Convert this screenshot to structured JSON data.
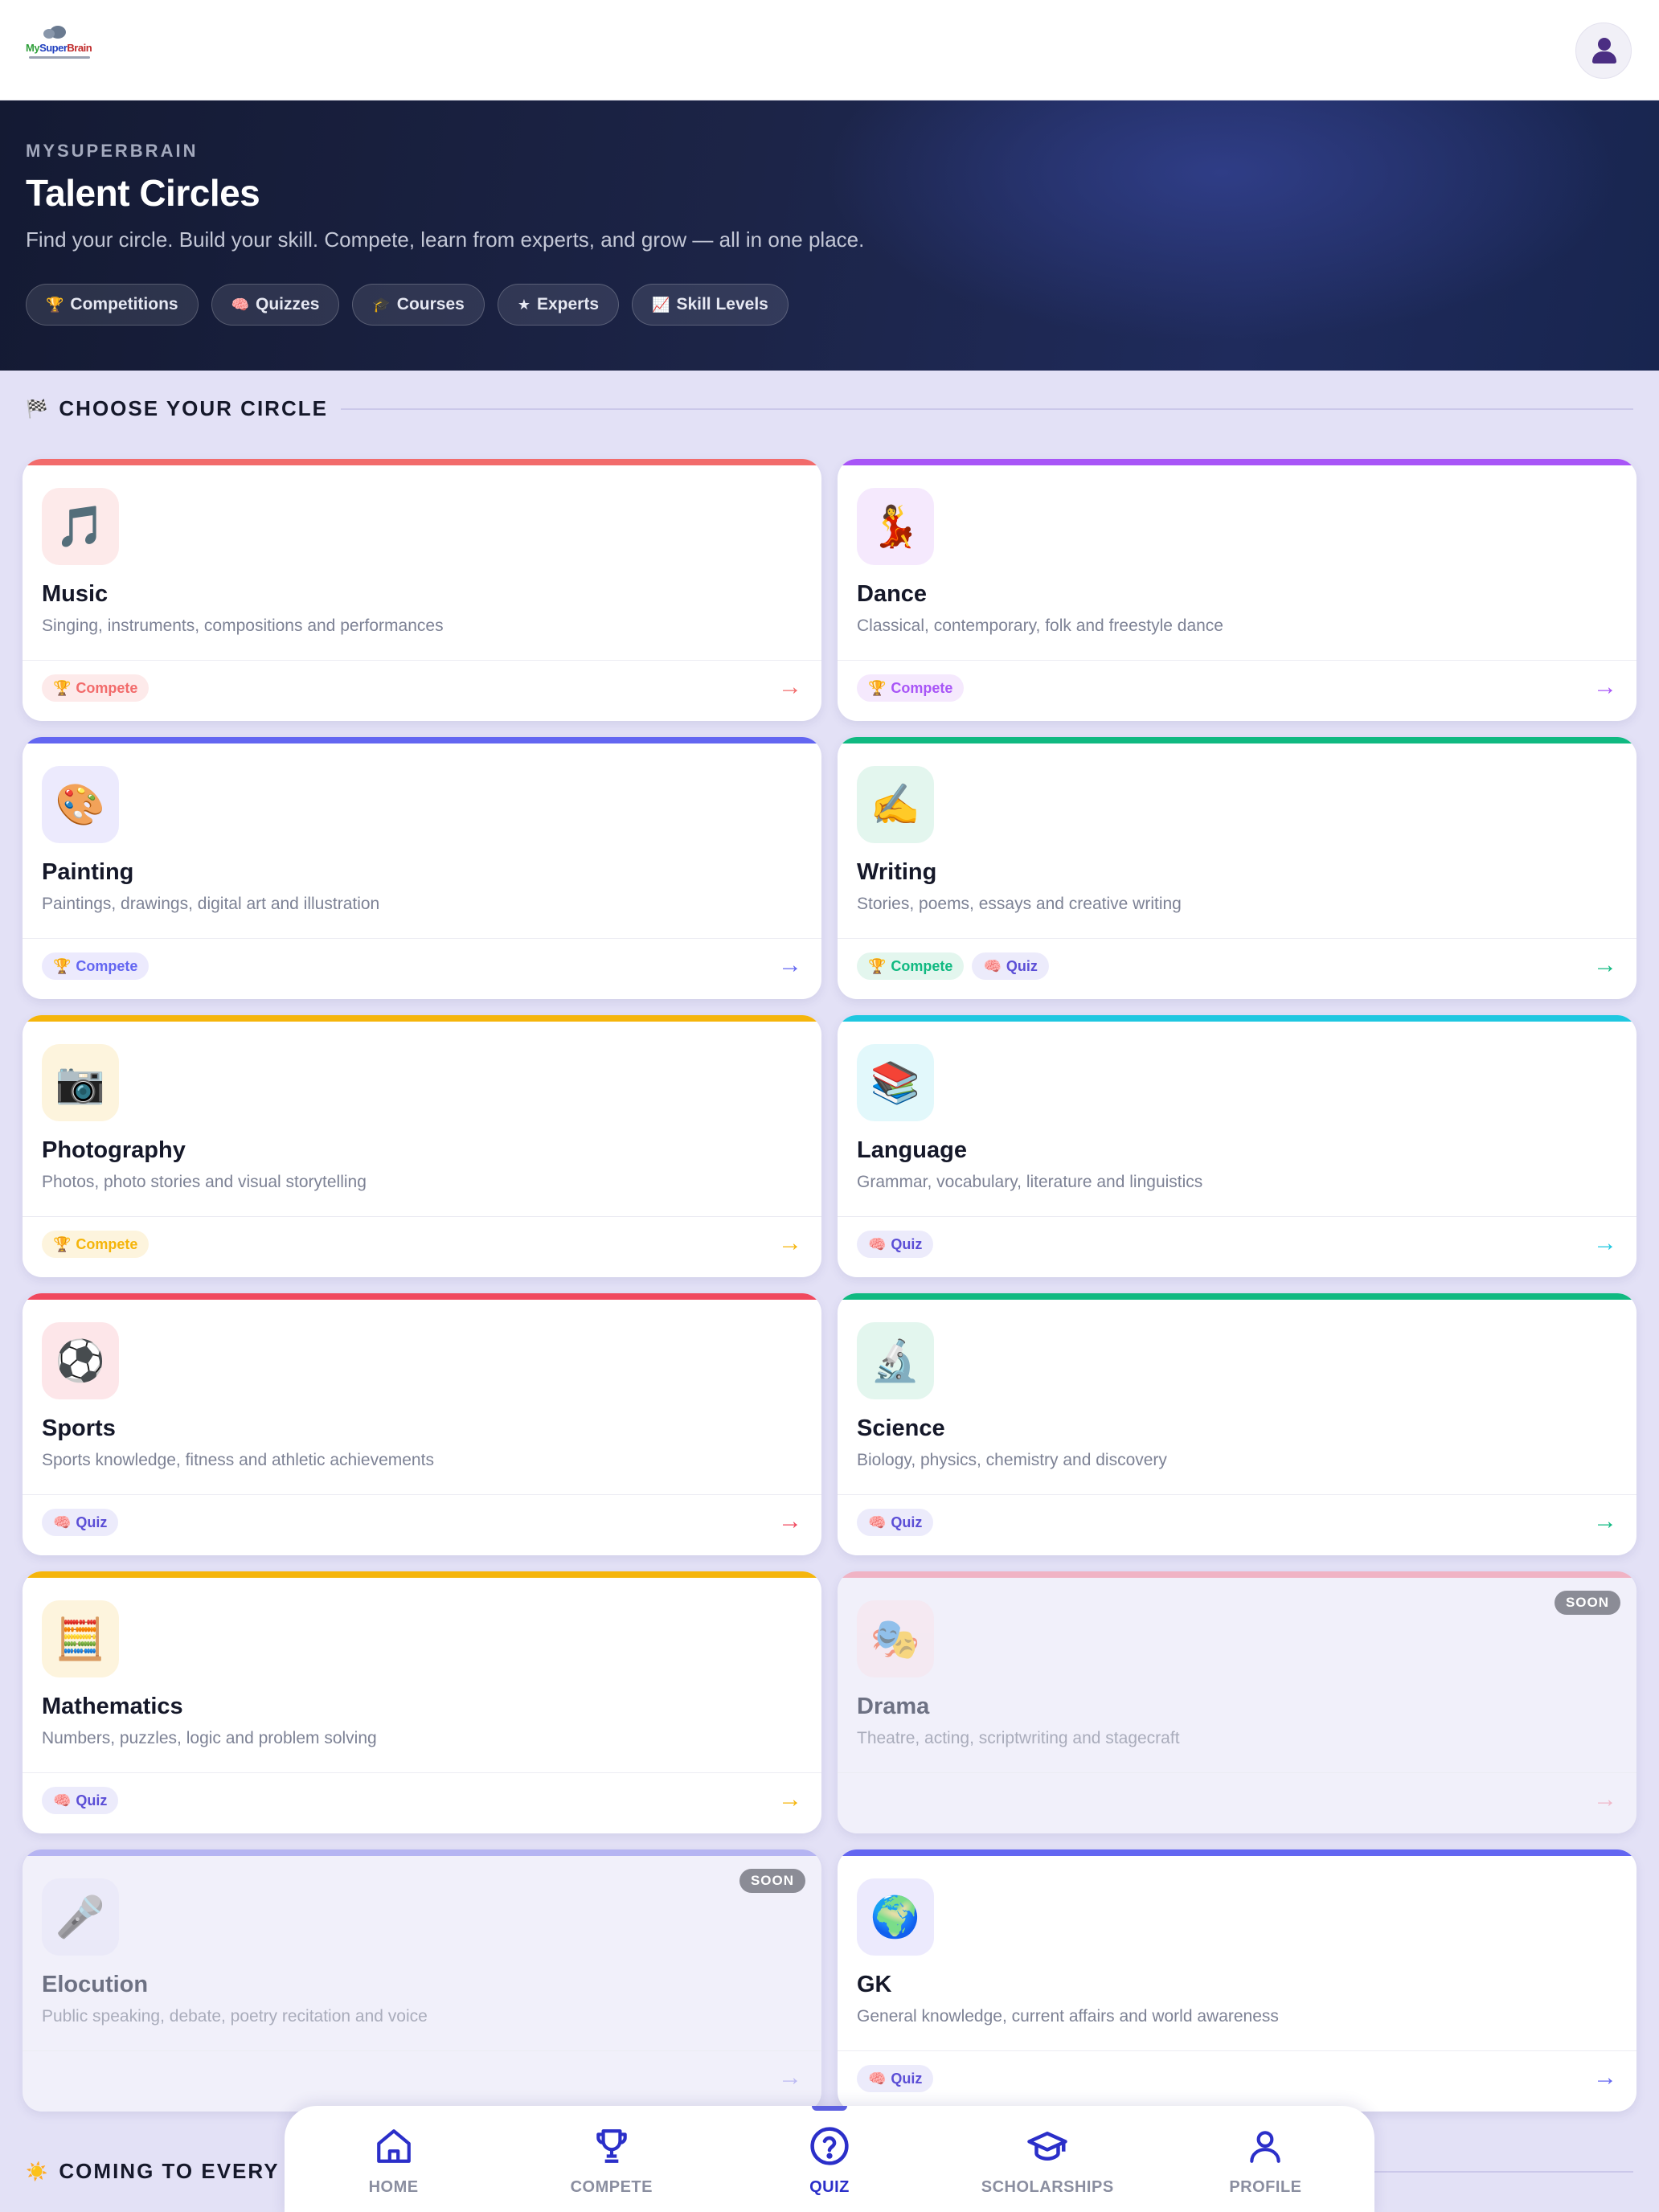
{
  "header": {
    "logo_text": "MySuperBrain"
  },
  "hero": {
    "eyebrow": "MYSUPERBRAIN",
    "title": "Talent Circles",
    "subtitle": "Find your circle. Build your skill. Compete, learn from experts, and grow — all in one place.",
    "pills": [
      {
        "icon": "🏆",
        "label": "Competitions"
      },
      {
        "icon": "🧠",
        "label": "Quizzes"
      },
      {
        "icon": "🎓",
        "label": "Courses"
      },
      {
        "icon": "★",
        "label": "Experts"
      },
      {
        "icon": "📈",
        "label": "Skill Levels"
      }
    ]
  },
  "section_circles": {
    "icon": "🏁",
    "title": "CHOOSE YOUR CIRCLE"
  },
  "section_coming": {
    "icon": "☀️",
    "title": "COMING TO EVERY CIRCLE"
  },
  "circles": [
    {
      "id": "music",
      "icon": "🎵",
      "name": "Music",
      "desc": "Singing, instruments, compositions and performances",
      "accent": "#f26b6b",
      "tint": "#fdeaea",
      "compete": true,
      "quiz": false,
      "soon": false
    },
    {
      "id": "dance",
      "icon": "💃",
      "name": "Dance",
      "desc": "Classical, contemporary, folk and freestyle dance",
      "accent": "#a855f7",
      "tint": "#f5e9fd",
      "compete": true,
      "quiz": false,
      "soon": false
    },
    {
      "id": "painting",
      "icon": "🎨",
      "name": "Painting",
      "desc": "Paintings, drawings, digital art and illustration",
      "accent": "#6366f1",
      "tint": "#eceafd",
      "compete": true,
      "quiz": false,
      "soon": false
    },
    {
      "id": "writing",
      "icon": "✍️",
      "name": "Writing",
      "desc": "Stories, poems, essays and creative writing",
      "accent": "#10b981",
      "tint": "#e3f6ee",
      "compete": true,
      "quiz": true,
      "soon": false
    },
    {
      "id": "photography",
      "icon": "📷",
      "name": "Photography",
      "desc": "Photos, photo stories and visual storytelling",
      "accent": "#f5b50b",
      "tint": "#fdf4dd",
      "compete": true,
      "quiz": false,
      "soon": false
    },
    {
      "id": "language",
      "icon": "📚",
      "name": "Language",
      "desc": "Grammar, vocabulary, literature and linguistics",
      "accent": "#1fc7e0",
      "tint": "#e2f8fb",
      "compete": false,
      "quiz": true,
      "soon": false
    },
    {
      "id": "sports",
      "icon": "⚽",
      "name": "Sports",
      "desc": "Sports knowledge, fitness and athletic achievements",
      "accent": "#f0485e",
      "tint": "#fde6e9",
      "compete": false,
      "quiz": true,
      "soon": false
    },
    {
      "id": "science",
      "icon": "🔬",
      "name": "Science",
      "desc": "Biology, physics, chemistry and discovery",
      "accent": "#10b981",
      "tint": "#e3f6ee",
      "compete": false,
      "quiz": true,
      "soon": false
    },
    {
      "id": "mathematics",
      "icon": "🧮",
      "name": "Mathematics",
      "desc": "Numbers, puzzles, logic and problem solving",
      "accent": "#f5b50b",
      "tint": "#fdf4dd",
      "compete": false,
      "quiz": true,
      "soon": false
    },
    {
      "id": "drama",
      "icon": "🎭",
      "name": "Drama",
      "desc": "Theatre, acting, scriptwriting and stagecraft",
      "accent": "#f08aa0",
      "tint": "#f7e4ec",
      "compete": false,
      "quiz": false,
      "soon": true
    },
    {
      "id": "elocution",
      "icon": "🎤",
      "name": "Elocution",
      "desc": "Public speaking, debate, poetry recitation and voice",
      "accent": "#8e8cec",
      "tint": "#e6e5f8",
      "compete": false,
      "quiz": false,
      "soon": true
    },
    {
      "id": "gk",
      "icon": "🌍",
      "name": "GK",
      "desc": "General knowledge, current affairs and world awareness",
      "accent": "#6366f1",
      "tint": "#eceafd",
      "compete": false,
      "quiz": true,
      "soon": false
    }
  ],
  "tag_labels": {
    "compete": "Compete",
    "quiz": "Quiz",
    "compete_icon": "🏆",
    "quiz_icon": "🧠",
    "arrow": "→",
    "soon": "SOON"
  },
  "nav": [
    {
      "id": "home",
      "label": "HOME",
      "icon": "home-icon",
      "active": false
    },
    {
      "id": "compete",
      "label": "COMPETE",
      "icon": "trophy-icon",
      "active": false
    },
    {
      "id": "quiz",
      "label": "QUIZ",
      "icon": "question-icon",
      "active": true
    },
    {
      "id": "scholarships",
      "label": "SCHOLARSHIPS",
      "icon": "graduation-cap-icon",
      "active": false
    },
    {
      "id": "profile",
      "label": "PROFILE",
      "icon": "user-icon",
      "active": false
    }
  ]
}
